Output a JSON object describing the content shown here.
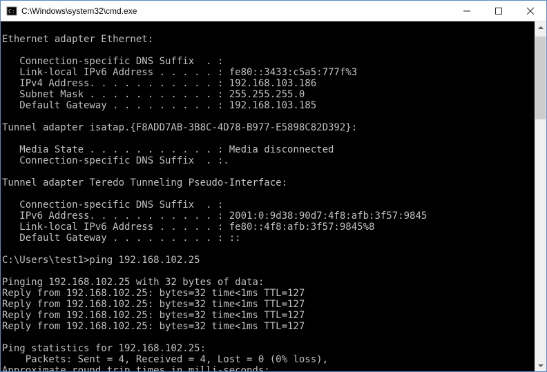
{
  "window": {
    "title": "C:\\Windows\\system32\\cmd.exe"
  },
  "lines": [
    "",
    "Ethernet adapter Ethernet:",
    "",
    "   Connection-specific DNS Suffix  . :",
    "   Link-local IPv6 Address . . . . . : fe80::3433:c5a5:777f%3",
    "   IPv4 Address. . . . . . . . . . . : 192.168.103.186",
    "   Subnet Mask . . . . . . . . . . . : 255.255.255.0",
    "   Default Gateway . . . . . . . . . : 192.168.103.185",
    "",
    "Tunnel adapter isatap.{F8ADD7AB-3B8C-4D78-B977-E5898C82D392}:",
    "",
    "   Media State . . . . . . . . . . . : Media disconnected",
    "   Connection-specific DNS Suffix  . :.",
    "",
    "Tunnel adapter Teredo Tunneling Pseudo-Interface:",
    "",
    "   Connection-specific DNS Suffix  . :",
    "   IPv6 Address. . . . . . . . . . . : 2001:0:9d38:90d7:4f8:afb:3f57:9845",
    "   Link-local IPv6 Address . . . . . : fe80::4f8:afb:3f57:9845%8",
    "   Default Gateway . . . . . . . . . : ::",
    "",
    "C:\\Users\\test1>ping 192.168.102.25",
    "",
    "Pinging 192.168.102.25 with 32 bytes of data:",
    "Reply from 192.168.102.25: bytes=32 time<1ms TTL=127",
    "Reply from 192.168.102.25: bytes=32 time<1ms TTL=127",
    "Reply from 192.168.102.25: bytes=32 time<1ms TTL=127",
    "Reply from 192.168.102.25: bytes=32 time<1ms TTL=127",
    "",
    "Ping statistics for 192.168.102.25:",
    "    Packets: Sent = 4, Received = 4, Lost = 0 (0% loss),",
    "Approximate round trip times in milli-seconds:"
  ]
}
